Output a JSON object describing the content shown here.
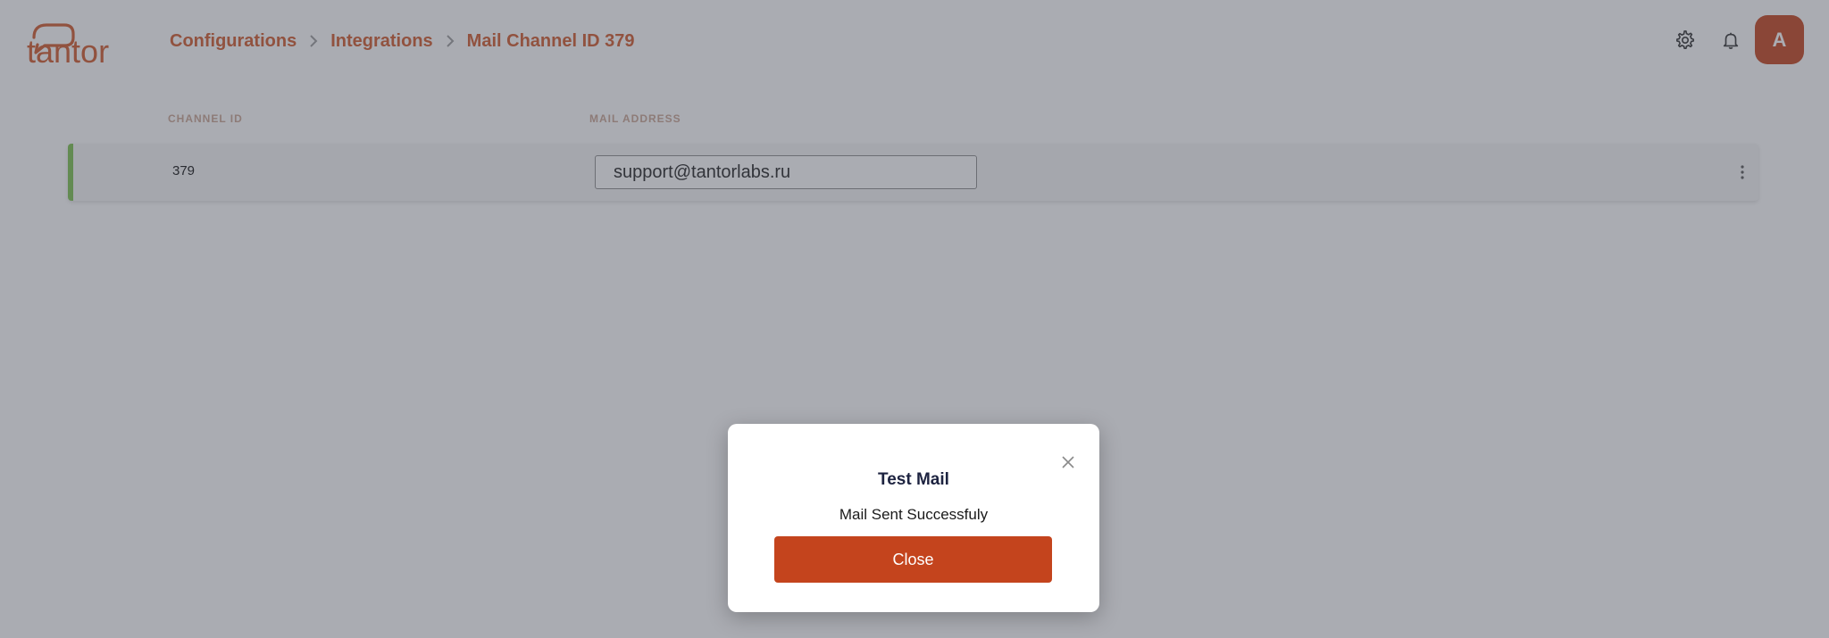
{
  "brand": {
    "logo_text": "tantor",
    "accent_color": "#c4441d",
    "status_color": "#7dc24e"
  },
  "breadcrumb": {
    "items": [
      {
        "label": "Configurations"
      },
      {
        "label": "Integrations"
      },
      {
        "label": "Mail Channel ID 379"
      }
    ],
    "separator_icon": "chevron-right-icon"
  },
  "header": {
    "icons": [
      "gear-icon",
      "bell-icon"
    ],
    "avatar_initial": "A"
  },
  "table": {
    "columns": [
      "CHANNEL ID",
      "MAIL ADDRESS"
    ],
    "rows": [
      {
        "channel_id": "379",
        "mail_address": "support@tantorlabs.ru",
        "menu_icon": "more-vertical-icon"
      }
    ]
  },
  "modal": {
    "title": "Test Mail",
    "message": "Mail Sent Successfuly",
    "button_label": "Close",
    "close_icon": "close-icon"
  }
}
